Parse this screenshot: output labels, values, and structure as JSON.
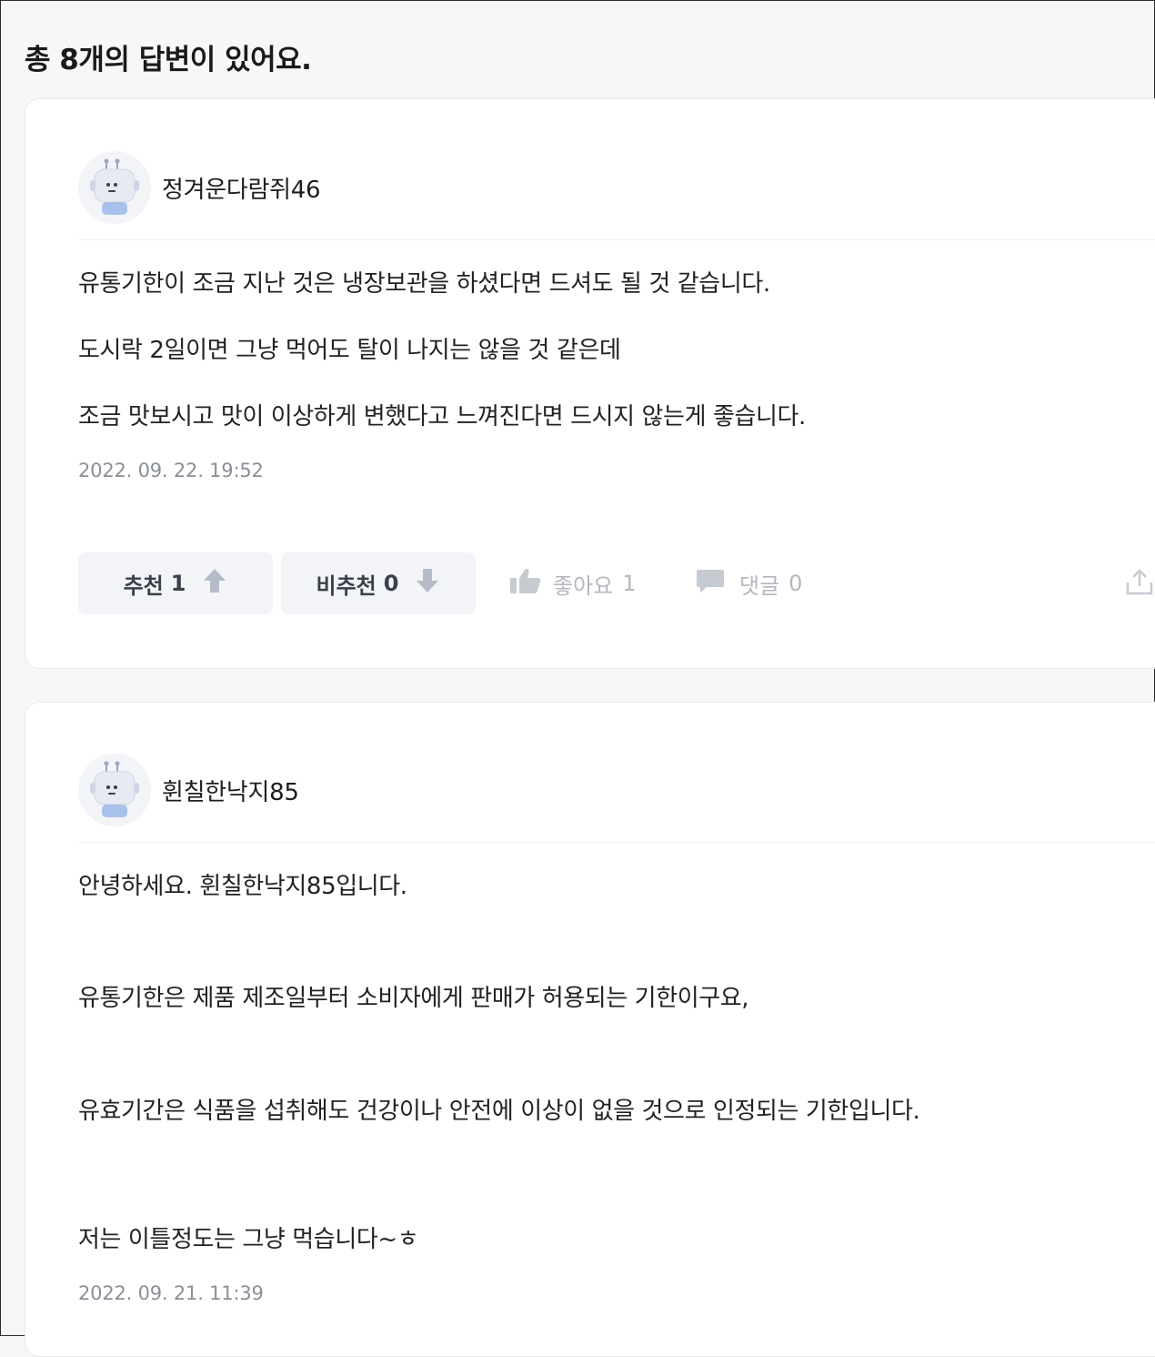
{
  "header": {
    "title": "총 8개의 답변이 있어요."
  },
  "answers": [
    {
      "author": "정겨운다람쥐46",
      "paragraphs": [
        "유통기한이 조금 지난 것은 냉장보관을 하셨다면 드셔도 될 것 같습니다.",
        "도시락 2일이면 그냥 먹어도 탈이 나지는 않을 것 같은데",
        "조금 맛보시고 맛이 이상하게 변했다고 느껴진다면 드시지 않는게 좋습니다."
      ],
      "timestamp": "2022. 09. 22. 19:52",
      "actions": {
        "recommend_label": "추천",
        "recommend_count": "1",
        "unrecommend_label": "비추천",
        "unrecommend_count": "0",
        "like_label": "좋아요",
        "like_count": "1",
        "comment_label": "댓글",
        "comment_count": "0"
      }
    },
    {
      "author": "휜칠한낙지85",
      "paragraphs": [
        "안녕하세요. 휜칠한낙지85입니다.",
        "유통기한은 제품 제조일부터 소비자에게 판매가 허용되는 기한이구요,",
        "유효기간은 식품을 섭취해도 건강이나 안전에 이상이 없을 것으로 인정되는 기한입니다.",
        "저는 이틀정도는 그냥 먹습니다~ㅎ"
      ],
      "timestamp": "2022. 09. 21. 11:39"
    }
  ],
  "icons": {
    "avatar": "robot-avatar-icon",
    "recommend": "arrow-up-icon",
    "unrecommend": "arrow-down-icon",
    "like": "thumbs-up-icon",
    "comment": "comment-bubble-icon",
    "share": "share-icon"
  },
  "colors": {
    "background": "#f7f7f8",
    "card": "#ffffff",
    "vote_button_bg": "#f2f4f7",
    "muted_text": "#8a8f99",
    "icon_gray": "#b3b7bf"
  }
}
